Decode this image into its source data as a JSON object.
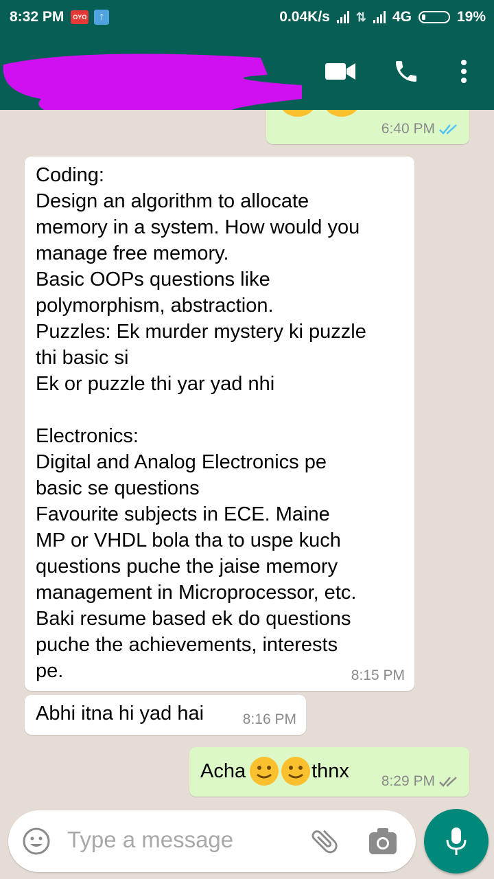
{
  "status_bar": {
    "time": "8:32 PM",
    "oyo_label": "OYO",
    "network_speed": "0.04K/s",
    "network_type": "4G",
    "battery": "19%"
  },
  "header": {
    "icons": [
      "video-call-icon",
      "phone-icon",
      "more-icon"
    ],
    "accent_color": "#075e54"
  },
  "messages": [
    {
      "direction": "out",
      "text": "",
      "time": "6:40 PM",
      "ticks": "read"
    },
    {
      "direction": "in",
      "text": "Coding:\nDesign an algorithm to allocate\nmemory in a system. How would you\nmanage free memory.\nBasic OOPs questions like\npolymorphism, abstraction.\nPuzzles: Ek murder mystery ki puzzle\nthi basic si\nEk or puzzle thi yar yad nhi\n\nElectronics:\nDigital and Analog Electronics pe\nbasic se questions\nFavourite subjects in ECE. Maine\nMP or VHDL bola tha to uspe kuch\nquestions puche the jaise memory\nmanagement in Microprocessor, etc.\nBaki resume based ek do questions\npuche the achievements, interests\npe.",
      "time": "8:15 PM"
    },
    {
      "direction": "in",
      "text": "Abhi itna hi yad hai",
      "time": "8:16 PM"
    },
    {
      "direction": "out",
      "text_before": "Acha",
      "text_after": "thnx",
      "time": "8:29 PM",
      "ticks": "delivered"
    }
  ],
  "input": {
    "placeholder": "Type a message"
  },
  "colors": {
    "chat_bg": "#e5ddd5",
    "outgoing_bubble": "#dcf8c6",
    "incoming_bubble": "#ffffff",
    "read_tick": "#4fc3f7",
    "mic_button": "#00897b"
  }
}
